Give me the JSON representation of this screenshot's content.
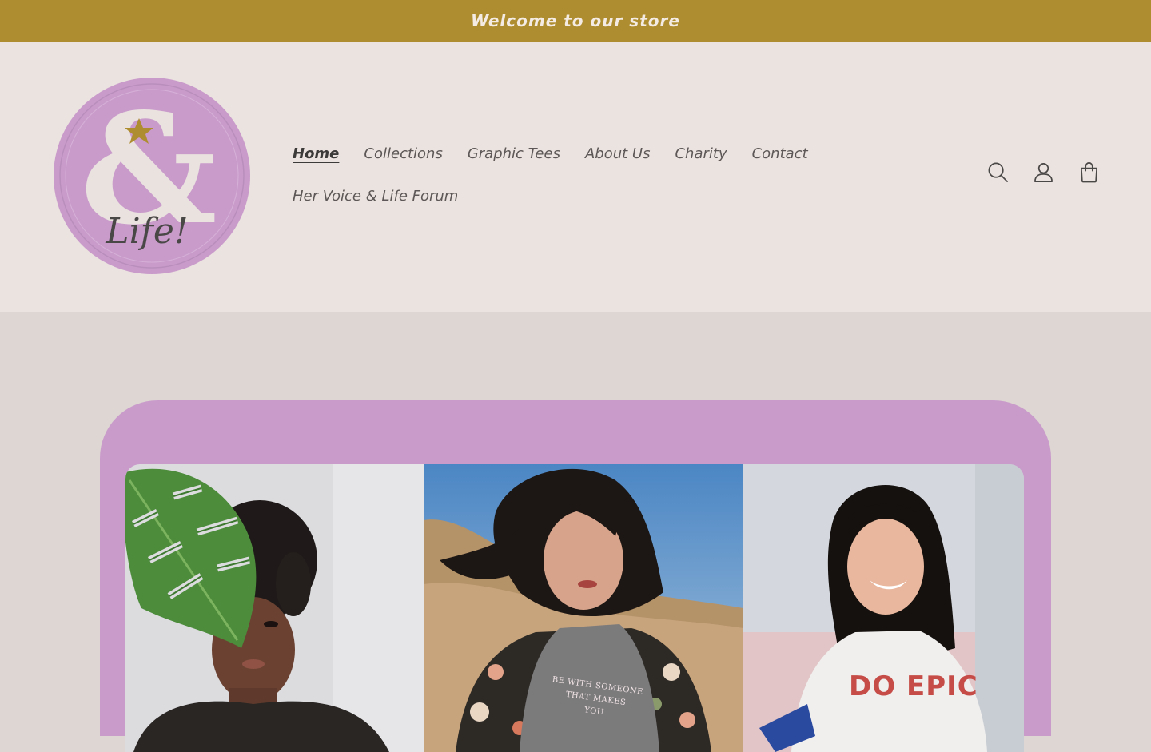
{
  "announcement": {
    "text": "Welcome to our store"
  },
  "colors": {
    "announcement_bg": "#ae8d30",
    "header_bg": "#ebe3df",
    "page_bg": "#ddd6d2",
    "brand_lilac": "#c99bcb",
    "star_gold": "#ae8d30",
    "text_dark": "#5d5857"
  },
  "logo": {
    "text": "Life!",
    "icon": "ampersand-star-logo"
  },
  "nav": {
    "items": [
      {
        "label": "Home",
        "active": true
      },
      {
        "label": "Collections",
        "active": false
      },
      {
        "label": "Graphic Tees",
        "active": false
      },
      {
        "label": "About Us",
        "active": false
      },
      {
        "label": "Charity",
        "active": false
      },
      {
        "label": "Contact",
        "active": false
      },
      {
        "label": "Her Voice & Life Forum",
        "active": false
      }
    ]
  },
  "header_icons": {
    "search": "search-icon",
    "account": "account-icon",
    "cart": "cart-icon"
  },
  "hero": {
    "panels": [
      {
        "subject": "woman-with-monstera-leaf"
      },
      {
        "subject": "woman-in-grey-tee-and-floral-kimono"
      },
      {
        "subject": "smiling-woman-in-white-tee"
      }
    ],
    "panel_2_print": [
      "BE WITH SOMEONE",
      "THAT MAKES",
      "YOU"
    ],
    "panel_3_print": "DO EPIC"
  }
}
